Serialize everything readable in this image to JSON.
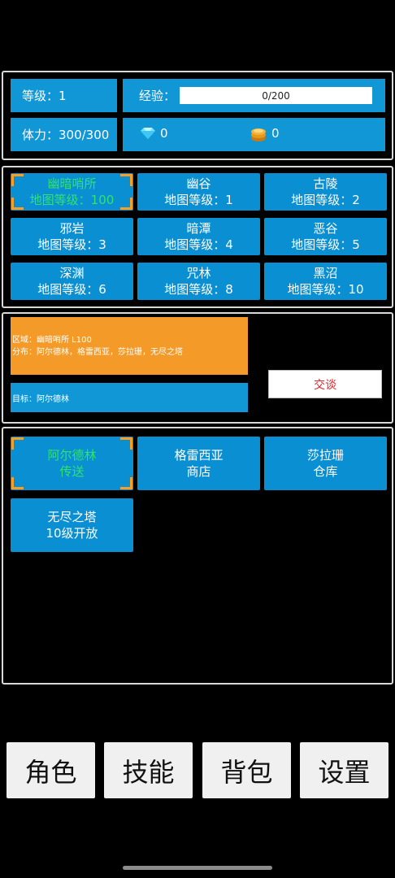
{
  "status": {
    "level_label": "等级：1",
    "exp_label": "经验：",
    "exp_text": "0/200",
    "exp_progress": 0,
    "stamina_label": "体力：300/300",
    "diamonds": "0",
    "coins": "0"
  },
  "maps": [
    {
      "name": "幽暗哨所",
      "level": "地图等级：100",
      "selected": true
    },
    {
      "name": "幽谷",
      "level": "地图等级：1"
    },
    {
      "name": "古陵",
      "level": "地图等级：2"
    },
    {
      "name": "邪岩",
      "level": "地图等级：3"
    },
    {
      "name": "暗潭",
      "level": "地图等级：4"
    },
    {
      "name": "恶谷",
      "level": "地图等级：5"
    },
    {
      "name": "深渊",
      "level": "地图等级：6"
    },
    {
      "name": "咒林",
      "level": "地图等级：8"
    },
    {
      "name": "黑沼",
      "level": "地图等级：10"
    }
  ],
  "info": {
    "region": "区域：幽暗哨所 L100",
    "distribution": "分布：阿尔德林，格雷西亚，莎拉珊，无尽之塔",
    "target": "目标：阿尔德林",
    "talk_button": "交谈"
  },
  "npcs": [
    {
      "line1": "阿尔德林",
      "line2": "传送",
      "selected": true
    },
    {
      "line1": "格雷西亚",
      "line2": "商店"
    },
    {
      "line1": "莎拉珊",
      "line2": "仓库"
    },
    {
      "line1": "无尽之塔",
      "line2": "10级开放"
    }
  ],
  "nav": {
    "character": "角色",
    "skills": "技能",
    "backpack": "背包",
    "settings": "设置"
  },
  "colors": {
    "panel_blue": "#0a8fd3",
    "selected_text": "#31e36b",
    "corner_orange": "#f0a12b",
    "info_orange": "#f39a28",
    "talk_text": "#d9262b"
  }
}
